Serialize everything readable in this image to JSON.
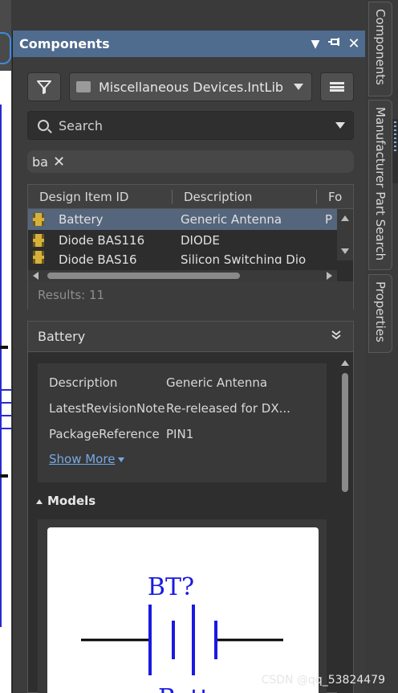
{
  "panel": {
    "title": "Components",
    "controls": {
      "dropdown": "▼",
      "pin": "📌",
      "close": "✕"
    }
  },
  "toolbar": {
    "library": "Miscellaneous Devices.IntLib"
  },
  "search": {
    "placeholder": "Search",
    "filter_text": "ba"
  },
  "grid": {
    "columns": [
      "Design Item ID",
      "Description",
      "Fo"
    ],
    "rows": [
      {
        "id": "Battery",
        "description": "Generic Antenna",
        "footprint": "PI"
      },
      {
        "id": "Diode BAS116",
        "description": "DIODE",
        "footprint": ""
      },
      {
        "id": "Diode BAS16",
        "description": "Silicon Switching Dio",
        "footprint": ""
      }
    ],
    "results": "Results: 11"
  },
  "details": {
    "title": "Battery",
    "properties": [
      {
        "key": "Description",
        "value": "Generic Antenna"
      },
      {
        "key": "LatestRevisionNote",
        "value": "Re-released for DX..."
      },
      {
        "key": "PackageReference",
        "value": "PIN1"
      }
    ],
    "show_more": "Show More",
    "models_label": "Models",
    "designator": "BT?",
    "name_partial": "Batt"
  },
  "side_tabs": [
    "Components",
    "Manufacturer Part Search",
    "Properties"
  ],
  "watermark": "CSDN @qq_53824479",
  "colors": {
    "title_bar": "#4f6b8e",
    "selected_row": "#54657c",
    "link": "#76a8e6",
    "symbol": "#1a1ae0"
  }
}
